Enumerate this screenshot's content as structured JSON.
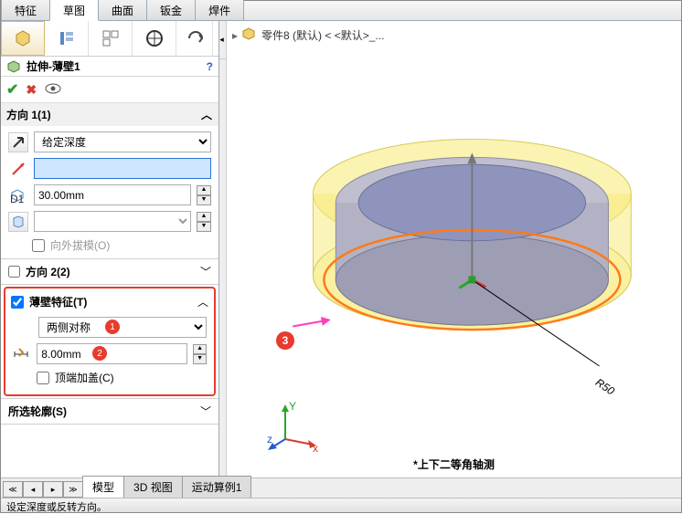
{
  "top_tabs": {
    "items": [
      "特征",
      "草图",
      "曲面",
      "钣金",
      "焊件"
    ],
    "active": "草图"
  },
  "breadcrumb": {
    "part": "零件8 (默认) < <默认>_..."
  },
  "panel": {
    "feature_title": "拉伸-薄壁1",
    "help_label": "?",
    "direction1": {
      "header": "方向 1(1)",
      "end_condition": "给定深度",
      "color_input": "",
      "depth": "30.00mm",
      "draft_outward_label": "向外拔模(O)"
    },
    "direction2": {
      "header": "方向 2(2)"
    },
    "thin": {
      "header": "薄壁特征(T)",
      "type": "两侧对称",
      "thickness": "8.00mm",
      "cap_ends_label": "顶端加盖(C)",
      "callout1": "1",
      "callout2": "2"
    },
    "selected_contours": {
      "header": "所选轮廓(S)"
    }
  },
  "viewport": {
    "subcaption": "*上下二等角轴测",
    "dimension_label": "R50",
    "marker3": "3",
    "triad": {
      "x": "x",
      "y": "Y",
      "z": "z"
    }
  },
  "bottom_tabs": {
    "items": [
      "模型",
      "3D 视图",
      "运动算例1"
    ],
    "active": "模型"
  },
  "status": "设定深度或反转方向。",
  "header_icons": [
    "zoom-fit",
    "zoom-area",
    "rotate-view",
    "display-style",
    "edit-appearance"
  ]
}
